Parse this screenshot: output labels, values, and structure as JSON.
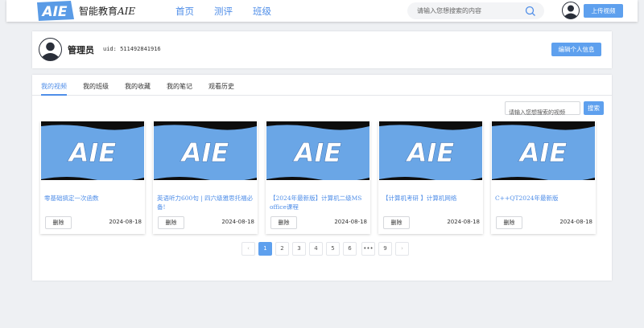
{
  "header": {
    "logo_text": "AIE",
    "brand": "智能教育",
    "brand_suffix": "AIE",
    "nav": [
      "首页",
      "测评",
      "班级"
    ],
    "search_placeholder": "请输入您想搜索的内容",
    "upload_label": "上传视频"
  },
  "profile": {
    "name": "管理员",
    "uid": "uid: 511492841916",
    "edit_label": "编辑个人信息"
  },
  "tabs": [
    "我的视频",
    "我的班级",
    "我的收藏",
    "我的笔记",
    "观看历史"
  ],
  "active_tab": 0,
  "video_search": {
    "placeholder": "请输入您想搜索的视频",
    "button": "搜索"
  },
  "videos": [
    {
      "thumb_text": "AIE",
      "title": "零基础搞定一次函数",
      "delete_label": "删除",
      "date": "2024-08-18"
    },
    {
      "thumb_text": "AIE",
      "title": "英语听力600句 | 四六级雅思托福必备!",
      "delete_label": "删除",
      "date": "2024-08-18"
    },
    {
      "thumb_text": "AIE",
      "title": "【2024年最新版】计算机二级MS office课程",
      "delete_label": "删除",
      "date": "2024-08-18"
    },
    {
      "thumb_text": "AIE",
      "title": "【计算机考研 】计算机网络",
      "delete_label": "删除",
      "date": "2024-08-18"
    },
    {
      "thumb_text": "AIE",
      "title": "C++QT2024年最新版",
      "delete_label": "删除",
      "date": "2024-08-18"
    }
  ],
  "pagination": {
    "prev": "‹",
    "pages": [
      "1",
      "2",
      "3",
      "4",
      "5",
      "6",
      "•••",
      "9"
    ],
    "next": "›",
    "current": "1"
  },
  "colors": {
    "accent": "#5ea0ee",
    "link": "#4f8ee8",
    "thumb_bg": "#6aa6e6"
  }
}
